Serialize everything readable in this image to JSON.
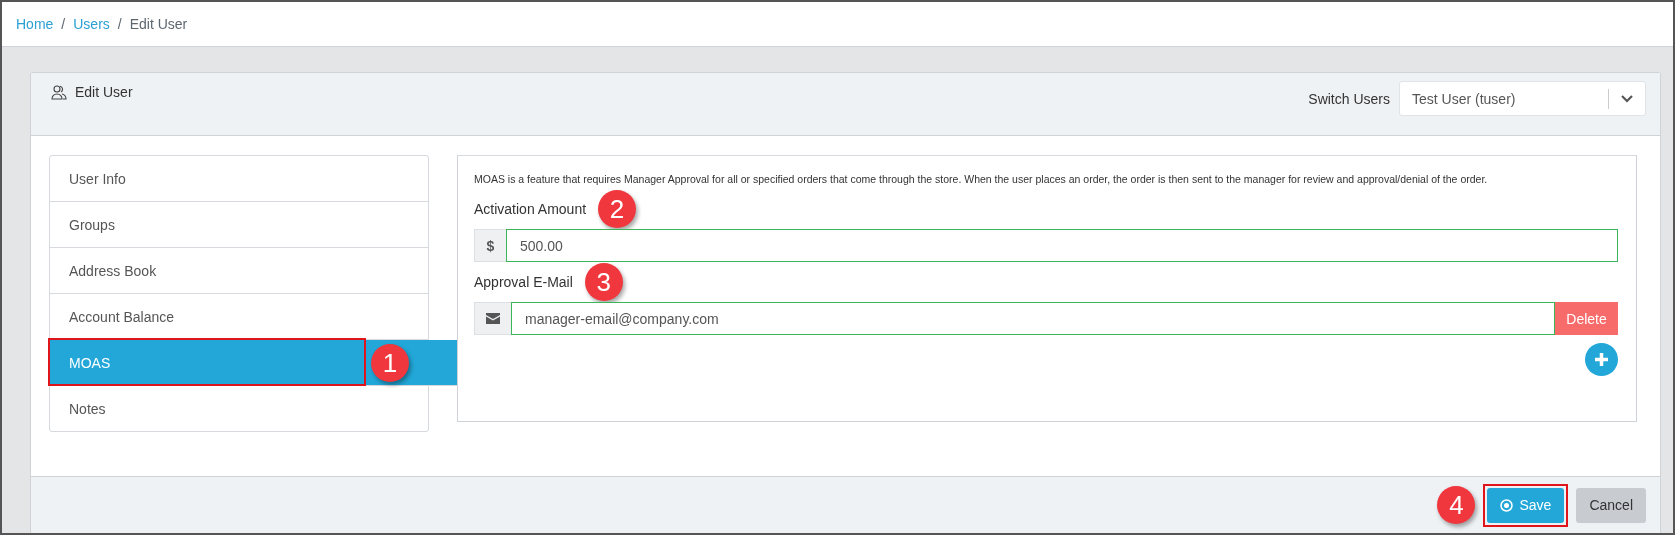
{
  "breadcrumb": [
    {
      "kind": "link",
      "label": "Home"
    },
    {
      "kind": "separator",
      "label": "/"
    },
    {
      "kind": "link",
      "label": "Users"
    },
    {
      "kind": "separator",
      "label": "/"
    },
    {
      "kind": "current",
      "label": "Edit User"
    }
  ],
  "card": {
    "title": "Edit User",
    "switch_label": "Switch Users",
    "switch_value": "Test User (tuser)"
  },
  "sidebar": {
    "items": [
      {
        "label": "User Info",
        "selected": false
      },
      {
        "label": "Groups",
        "selected": false
      },
      {
        "label": "Address Book",
        "selected": false
      },
      {
        "label": "Account Balance",
        "selected": false
      },
      {
        "label": "MOAS",
        "selected": true,
        "callout": "1"
      },
      {
        "label": "Notes",
        "selected": false
      }
    ]
  },
  "moas": {
    "description": "MOAS is a feature that requires Manager Approval for all or specified orders that come through the store. When the user places an order, the order is then sent to the manager for review and approval/denial of the order.",
    "amount_label": "Activation Amount",
    "amount_callout": "2",
    "amount_prefix": "$",
    "amount_value": "500.00",
    "email_label": "Approval E-Mail",
    "email_callout": "3",
    "email_value": "manager-email@company.com",
    "delete_label": "Delete"
  },
  "footer": {
    "save_label": "Save",
    "save_callout": "4",
    "cancel_label": "Cancel"
  }
}
